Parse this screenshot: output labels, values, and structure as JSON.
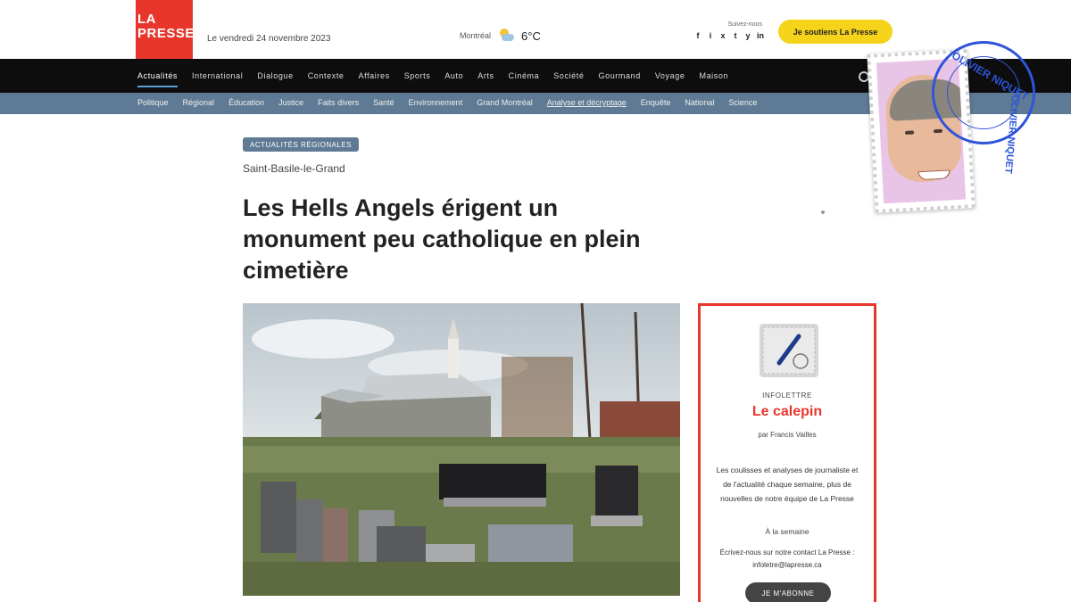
{
  "header": {
    "logo_line1": "LA",
    "logo_line2": "PRESSE",
    "date": "Le vendredi 24 novembre 2023",
    "weather_label": "Montréal",
    "temperature": "6°C",
    "social_label": "Suivez-nous",
    "social_icons": [
      "f",
      "i",
      "x",
      "t",
      "y",
      "in"
    ],
    "subscribe_label": "Je soutiens La Presse"
  },
  "main_nav": [
    "Actualités",
    "International",
    "Dialogue",
    "Contexte",
    "Affaires",
    "Sports",
    "Auto",
    "Arts",
    "Cinéma",
    "Société",
    "Gourmand",
    "Voyage",
    "Maison"
  ],
  "sub_nav": [
    "Politique",
    "Régional",
    "Éducation",
    "Justice",
    "Faits divers",
    "Santé",
    "Environnement",
    "Grand Montréal",
    "Analyse et décryptage",
    "Enquête",
    "National",
    "Science"
  ],
  "stamp": {
    "name": "OLIVIER NIQUET",
    "seal_top": "OLIVIER NIQUET",
    "seal_side": "OLIVIER NIQUET"
  },
  "article": {
    "category": "ACTUALITÉS RÉGIONALES",
    "location": "Saint-Basile-le-Grand",
    "headline": "Les Hells Angels érigent un monument peu catholique en plein cimetière"
  },
  "newsletter": {
    "kicker": "INFOLETTRE",
    "title": "Le calepin",
    "author": "par Francis Vailles",
    "description": "Les coulisses et analyses de journaliste et de l'actualité chaque semaine, plus de nouvelles de notre équipe de La Presse",
    "frequency": "À la semaine",
    "contact": "Écrivez-nous sur notre contact La Presse : infoletre@lapresse.ca",
    "button_label": "JE M'ABONNE"
  },
  "colors": {
    "brand_red": "#e8362d",
    "subscribe_yellow": "#f6d31b",
    "nav_black": "#0d0d0d",
    "subnav_blue": "#5e7a94",
    "seal_blue": "#2e54d9"
  }
}
